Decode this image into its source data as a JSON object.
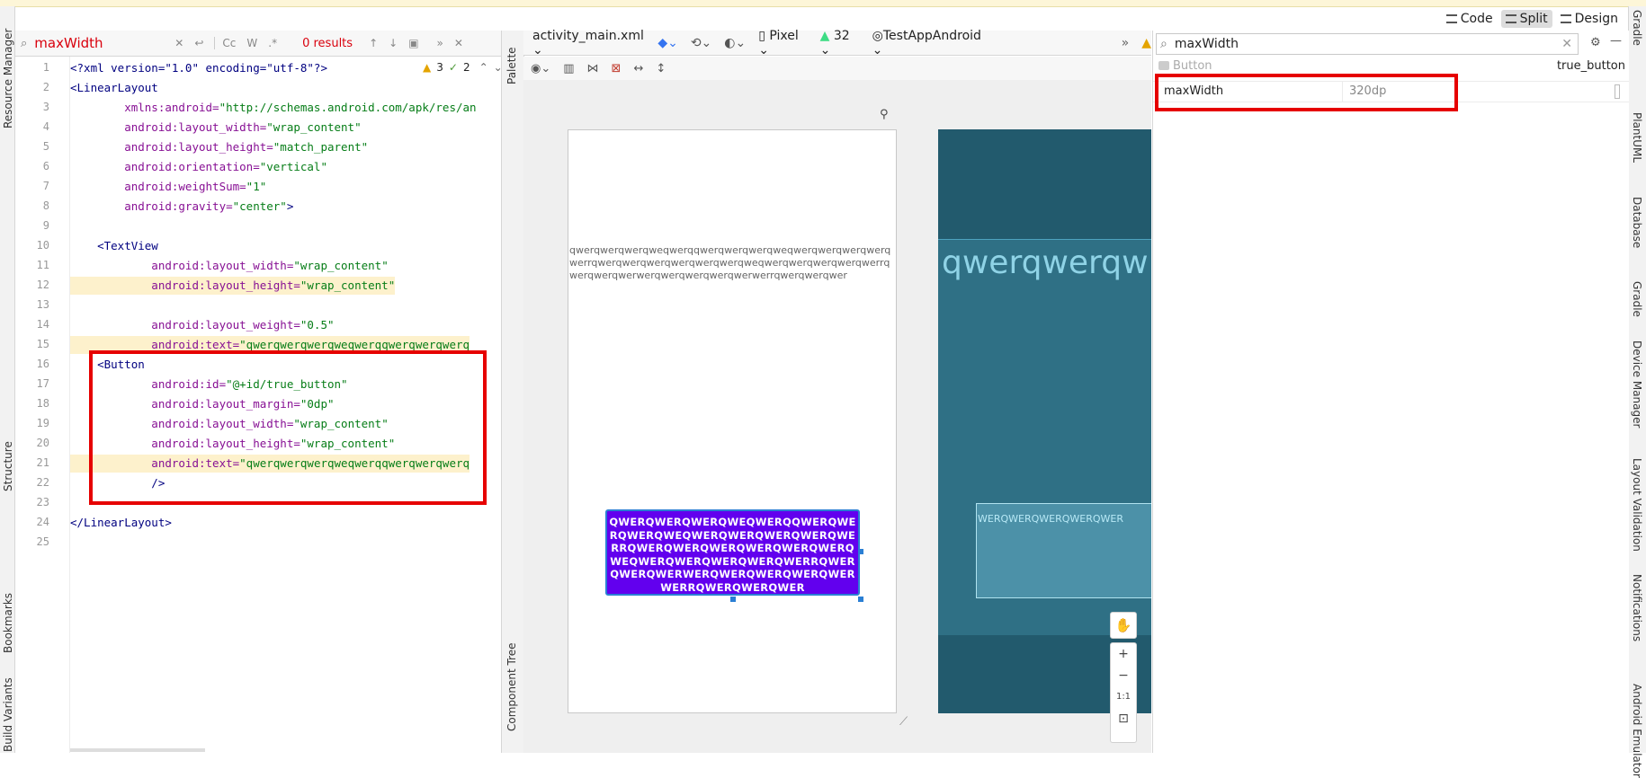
{
  "window": {
    "modes": [
      {
        "label": "Code",
        "active": false
      },
      {
        "label": "Split",
        "active": true
      },
      {
        "label": "Design",
        "active": false
      }
    ]
  },
  "left_strip": {
    "items": [
      "Resource Manager",
      "Structure",
      "Bookmarks",
      "Build Variants"
    ]
  },
  "right_strip": {
    "items": [
      "Gradle",
      "Database",
      "PlantUML",
      "Gradle",
      "Device Manager",
      "Layout Validation",
      "Notifications",
      "Android Emulator"
    ]
  },
  "editor_search": {
    "query": "maxWidth",
    "options": [
      "Cc",
      "W",
      ".*"
    ],
    "results": "0 results"
  },
  "editor_annotations": {
    "warnings": "3",
    "weak_warnings": "2"
  },
  "code": {
    "line_numbers": [
      "1",
      "2",
      "3",
      "4",
      "5",
      "6",
      "7",
      "8",
      "9",
      "10",
      "11",
      "12",
      "13",
      "14",
      "15",
      "16",
      "17",
      "18",
      "19",
      "20",
      "21",
      "22",
      "23",
      "24",
      "25"
    ],
    "lines": [
      {
        "n": "1",
        "parts": [
          {
            "t": "<?xml version=\"1.0\" encoding=\"utf-8\"?>",
            "c": "tag"
          }
        ]
      },
      {
        "n": "2",
        "parts": [
          {
            "t": "<LinearLayout",
            "c": "tag"
          }
        ]
      },
      {
        "n": "3",
        "parts": [
          {
            "t": "        xmlns:android=",
            "c": "attr"
          },
          {
            "t": "\"http://schemas.android.com/apk/res/an",
            "c": "val"
          }
        ]
      },
      {
        "n": "4",
        "parts": [
          {
            "t": "        android:layout_width=",
            "c": "attr"
          },
          {
            "t": "\"wrap_content\"",
            "c": "val"
          }
        ]
      },
      {
        "n": "5",
        "parts": [
          {
            "t": "        android:layout_height=",
            "c": "attr"
          },
          {
            "t": "\"match_parent\"",
            "c": "val"
          }
        ]
      },
      {
        "n": "6",
        "parts": [
          {
            "t": "        android:orientation=",
            "c": "attr"
          },
          {
            "t": "\"vertical\"",
            "c": "val"
          }
        ]
      },
      {
        "n": "7",
        "parts": [
          {
            "t": "        android:weightSum=",
            "c": "attr"
          },
          {
            "t": "\"1\"",
            "c": "val"
          }
        ]
      },
      {
        "n": "8",
        "parts": [
          {
            "t": "        android:gravity=",
            "c": "attr"
          },
          {
            "t": "\"center\"",
            "c": "val"
          },
          {
            "t": ">",
            "c": "tag"
          }
        ]
      },
      {
        "n": "9",
        "parts": []
      },
      {
        "n": "10",
        "parts": [
          {
            "t": "    <TextView",
            "c": "tag"
          }
        ]
      },
      {
        "n": "11",
        "parts": [
          {
            "t": "            android:layout_width=",
            "c": "attr"
          },
          {
            "t": "\"wrap_content\"",
            "c": "val"
          }
        ]
      },
      {
        "n": "12",
        "parts": [
          {
            "t": "            android:layout_height=",
            "c": "attr"
          },
          {
            "t": "\"wrap_content\"",
            "c": "val"
          }
        ]
      },
      {
        "n": "13",
        "parts": []
      },
      {
        "n": "14",
        "parts": [
          {
            "t": "            android:layout_weight=",
            "c": "attr"
          },
          {
            "t": "\"0.5\"",
            "c": "val"
          }
        ]
      },
      {
        "n": "15",
        "parts": [
          {
            "t": "            android:text=",
            "c": "attr"
          },
          {
            "t": "\"qwerqwerqwerqweqwerqqwerqwerqwerq",
            "c": "val"
          }
        ]
      },
      {
        "n": "16",
        "parts": [
          {
            "t": "    <Button",
            "c": "tag"
          }
        ]
      },
      {
        "n": "17",
        "parts": [
          {
            "t": "            android:id=",
            "c": "attr"
          },
          {
            "t": "\"@+id/true_button\"",
            "c": "val"
          }
        ]
      },
      {
        "n": "18",
        "parts": [
          {
            "t": "            android:layout_margin=",
            "c": "attr"
          },
          {
            "t": "\"0dp\"",
            "c": "val"
          }
        ]
      },
      {
        "n": "19",
        "parts": [
          {
            "t": "            android:layout_width=",
            "c": "attr"
          },
          {
            "t": "\"wrap_content\"",
            "c": "val"
          }
        ]
      },
      {
        "n": "20",
        "parts": [
          {
            "t": "            android:layout_height=",
            "c": "attr"
          },
          {
            "t": "\"wrap_content\"",
            "c": "val"
          }
        ]
      },
      {
        "n": "21",
        "parts": [
          {
            "t": "            android:text=",
            "c": "attr"
          },
          {
            "t": "\"qwerqwerqwerqweqwerqqwerqwerqwerq",
            "c": "val"
          }
        ]
      },
      {
        "n": "22",
        "parts": [
          {
            "t": "            />",
            "c": "tag"
          }
        ]
      },
      {
        "n": "23",
        "parts": []
      },
      {
        "n": "24",
        "parts": [
          {
            "t": "</LinearLayout>",
            "c": "tag"
          }
        ]
      },
      {
        "n": "25",
        "parts": []
      }
    ]
  },
  "palette_strip": {
    "palette": "Palette",
    "component_tree": "Component Tree"
  },
  "design_toolbar": {
    "file": "activity_main.xml",
    "device": "Pixel",
    "api": "32",
    "theme": "TestAppAndroid"
  },
  "preview": {
    "textview_text": "qwerqwerqwerqweqwerqqwerqwerqwerqweqwerqwerqwerqwerqwerrqwerqwerqwerqwerqwerqwerqweqwerqwerqwerqwerqwerrqwerqwerqwerwerqwerqwerqwerqwerwerrqwerqwerqwer",
    "button_text": "QWERQWERQWERQWEQWERQQWERQWERQWERQWEQWERQWERQWERQWERQWERRQWERQWERQWERQWERQWERQWERQWEQWERQWERQWERQWERQWERRQWERQWERQWERWERQWERQWERQWERQWERWERRQWERQWERQWER",
    "blueprint_text": "qwerqwerqw",
    "blueprint_button_text": "WERQWERQWERQWERQWER",
    "zoom_ratio": "1:1"
  },
  "attributes": {
    "search_query": "maxWidth",
    "component_type": "Button",
    "component_id": "true_button",
    "rows": [
      {
        "name": "maxWidth",
        "value": "320dp"
      }
    ]
  },
  "colors": {
    "button_purple": "#6200ee",
    "highlight_red": "#e60000",
    "blueprint_bg": "#225a6d"
  }
}
